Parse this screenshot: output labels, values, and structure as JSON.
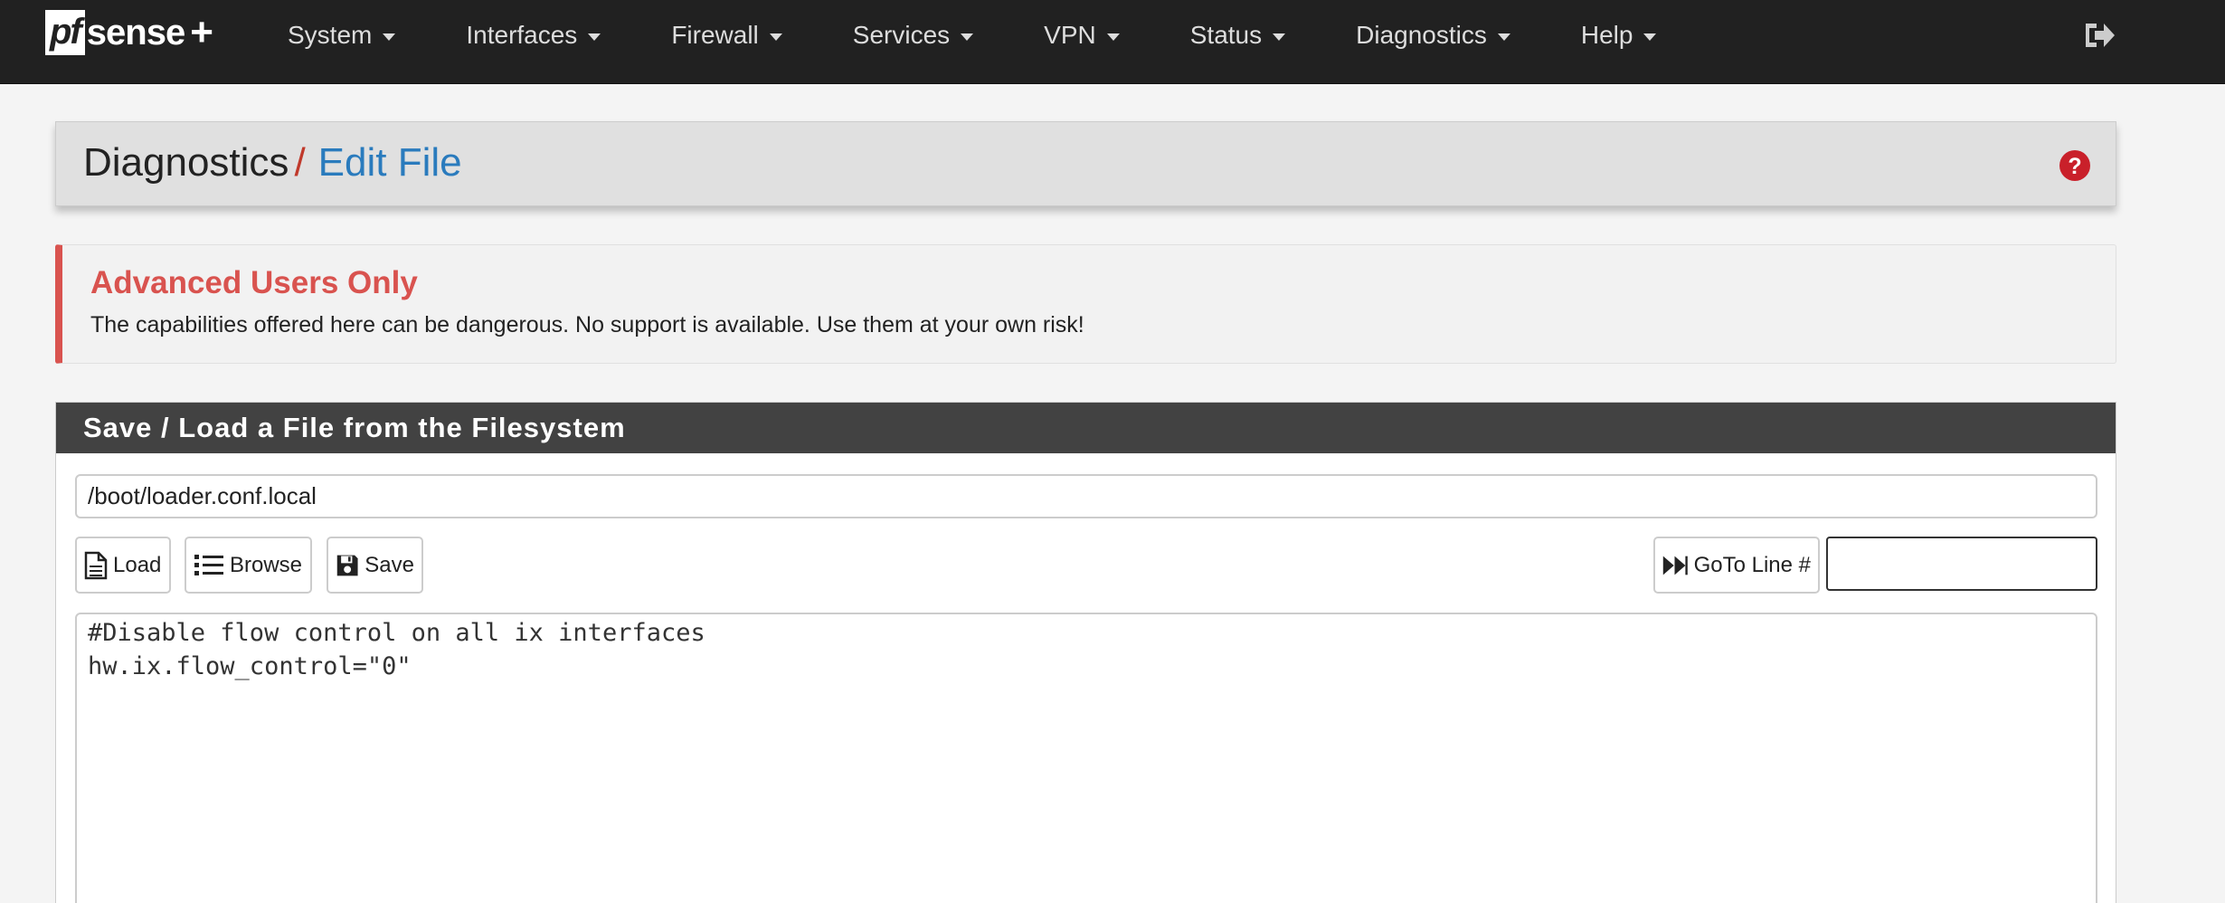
{
  "navbar": {
    "brand_pf": "pf",
    "brand_sense": "sense",
    "brand_plus": "+",
    "menu": [
      {
        "label": "System"
      },
      {
        "label": "Interfaces"
      },
      {
        "label": "Firewall"
      },
      {
        "label": "Services"
      },
      {
        "label": "VPN"
      },
      {
        "label": "Status"
      },
      {
        "label": "Diagnostics"
      },
      {
        "label": "Help"
      }
    ],
    "logout_icon": "sign-out-icon"
  },
  "breadcrumb": {
    "parent": "Diagnostics",
    "separator": "/",
    "current": "Edit File",
    "help_icon": "question-circle-icon"
  },
  "alert": {
    "title": "Advanced Users Only",
    "text": "The capabilities offered here can be dangerous. No support is available. Use them at your own risk!"
  },
  "panel": {
    "title": "Save / Load a File from the Filesystem",
    "file_path": "/boot/loader.conf.local",
    "buttons": {
      "load": "Load",
      "browse": "Browse",
      "save": "Save",
      "goto": "GoTo Line #"
    },
    "goto_value": "",
    "editor_content": "#Disable flow control on all ix interfaces\nhw.ix.flow_control=\"0\""
  },
  "colors": {
    "navbar_bg": "#212121",
    "accent_blue": "#2a7bbd",
    "danger_red": "#d9534f",
    "panel_heading_bg": "#424242"
  }
}
